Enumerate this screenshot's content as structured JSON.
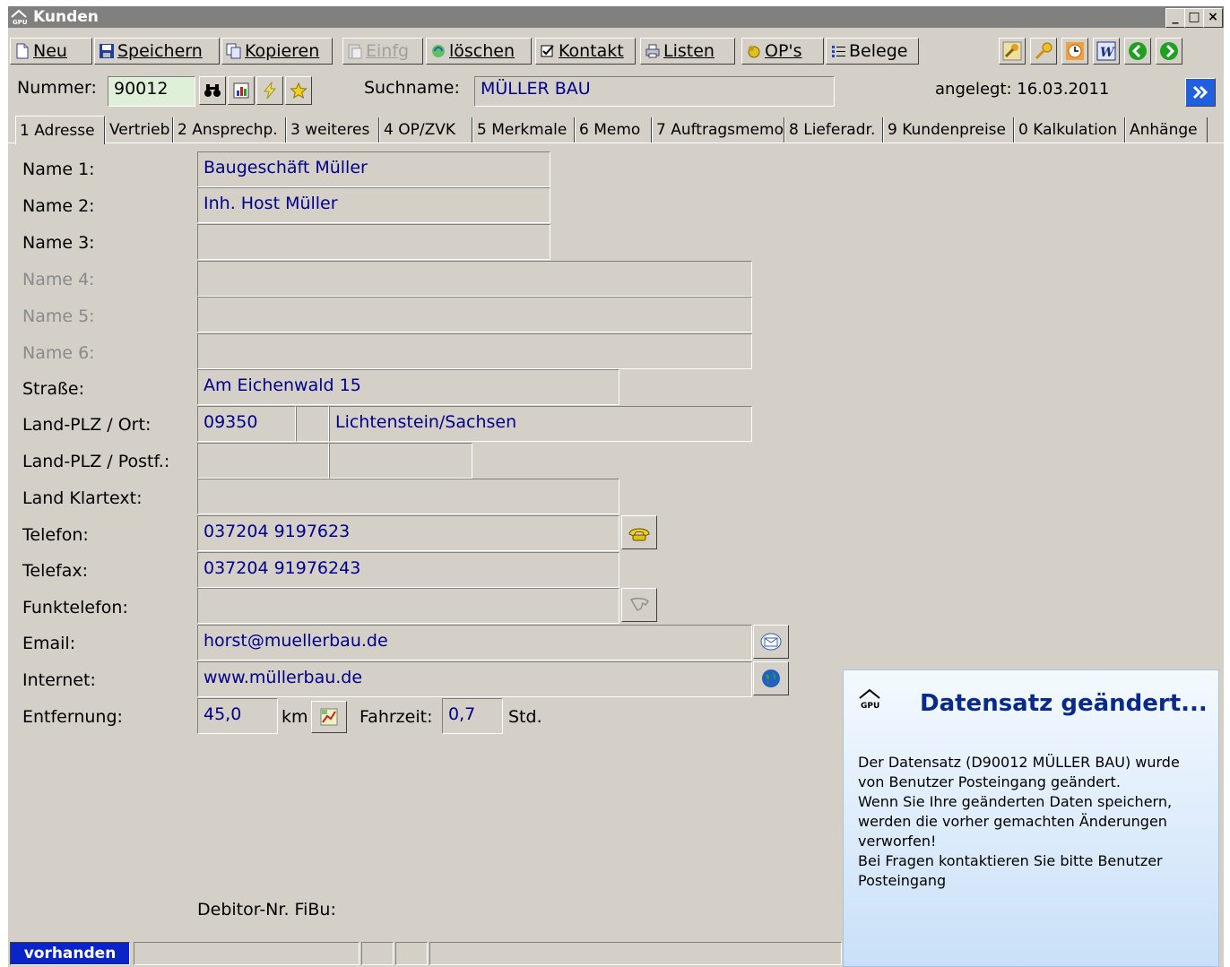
{
  "window": {
    "title": "Kunden",
    "app_icon": "gpu-logo-icon",
    "controls": [
      "_",
      "□",
      "×"
    ]
  },
  "toolbar": {
    "neu": "Neu",
    "speichern": "Speichern",
    "kopieren": "Kopieren",
    "einfg": "Einfg",
    "loeschen": "löschen",
    "kontakt": "Kontakt",
    "listen": "Listen",
    "ops": "OP's",
    "belege": "Belege"
  },
  "header": {
    "nummer_label": "Nummer:",
    "nummer_value": "90012",
    "suchname_label": "Suchname:",
    "suchname_value": "MÜLLER BAU",
    "angelegt": "angelegt: 16.03.2011"
  },
  "tabs": [
    {
      "label": "1 Adresse"
    },
    {
      "label": "Vertrieb"
    },
    {
      "label": "2 Ansprechp."
    },
    {
      "label": "3 weiteres"
    },
    {
      "label": "4 OP/ZVK"
    },
    {
      "label": "5 Merkmale"
    },
    {
      "label": "6 Memo"
    },
    {
      "label": "7 Auftragsmemo"
    },
    {
      "label": "8 Lieferadr."
    },
    {
      "label": "9 Kundenpreise"
    },
    {
      "label": "0 Kalkulation"
    },
    {
      "label": "Anhänge"
    }
  ],
  "form": {
    "name1_label": "Name 1:",
    "name1": "Baugeschäft Müller",
    "name2_label": "Name 2:",
    "name2": "Inh. Host Müller",
    "name3_label": "Name 3:",
    "name3": "",
    "name4_label": "Name 4:",
    "name5_label": "Name 5:",
    "name6_label": "Name 6:",
    "strasse_label": "Straße:",
    "strasse": "Am Eichenwald 15",
    "plz_ort_label": "Land-PLZ / Ort:",
    "plz": "09350",
    "ort": "Lichtenstein/Sachsen",
    "postf_label": "Land-PLZ / Postf.:",
    "land_klartext_label": "Land Klartext:",
    "telefon_label": "Telefon:",
    "telefon": "037204 9197623",
    "telefax_label": "Telefax:",
    "telefax": "037204 91976243",
    "funktelefon_label": "Funktelefon:",
    "email_label": "Email:",
    "email": "horst@muellerbau.de",
    "internet_label": "Internet:",
    "internet": "www.müllerbau.de",
    "entfernung_label": "Entfernung:",
    "entfernung": "45,0",
    "km": "km",
    "fahrzeit_label": "Fahrzeit:",
    "fahrzeit": "0,7",
    "std": "Std.",
    "debitor_label": "Debitor-Nr. FiBu:"
  },
  "status": {
    "state": "vorhanden"
  },
  "notification": {
    "title": "Datensatz geändert...",
    "lines": [
      "Der Datensatz (D90012 MÜLLER BAU) wurde",
      "von Benutzer Posteingang geändert.",
      "Wenn Sie Ihre geänderten Daten speichern,",
      "werden die vorher gemachten Änderungen",
      "verworfen!",
      "Bei Fragen kontaktieren Sie bitte Benutzer",
      "Posteingang"
    ]
  },
  "colors": {
    "face": "#d4d0c8",
    "field_text": "#00008b",
    "status_blue": "#0a24c8",
    "notif_title": "#0a2a8a"
  }
}
